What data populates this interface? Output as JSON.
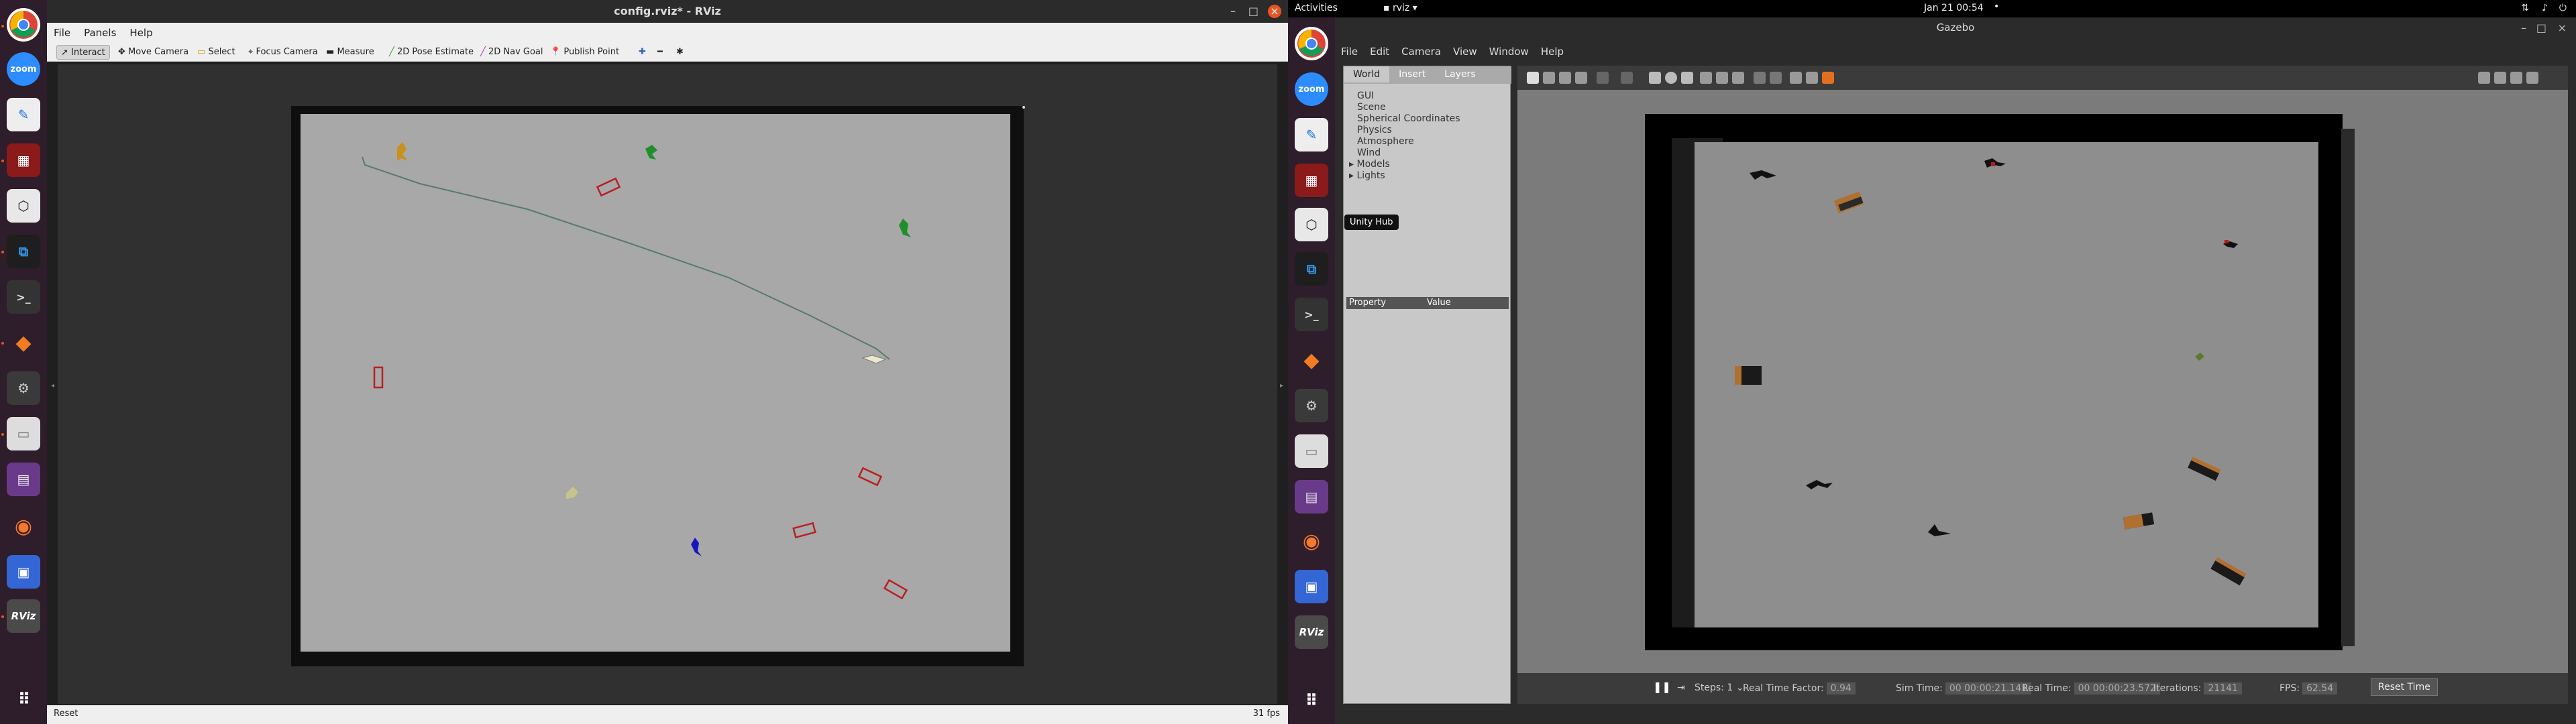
{
  "rviz": {
    "title": "config.rviz* - RViz",
    "menu": [
      "File",
      "Panels",
      "Help"
    ],
    "tools": [
      "Interact",
      "Move Camera",
      "Select",
      "Focus Camera",
      "Measure",
      "2D Pose Estimate",
      "2D Nav Goal",
      "Publish Point"
    ],
    "reset_label": "Reset",
    "fps": "31 fps"
  },
  "topbar": {
    "activities": "Activities",
    "app": "rviz",
    "datetime": "Jan 21  00:54"
  },
  "gazebo": {
    "title": "Gazebo",
    "menu": [
      "File",
      "Edit",
      "Camera",
      "View",
      "Window",
      "Help"
    ],
    "tabs": [
      "World",
      "Insert",
      "Layers"
    ],
    "tree": [
      "GUI",
      "Scene",
      "Spherical Coordinates",
      "Physics",
      "Atmosphere",
      "Wind",
      "Models",
      "Lights"
    ],
    "property_header": "Property",
    "value_header": "Value",
    "tooltip": "Unity Hub",
    "status": {
      "steps_label": "Steps:",
      "steps_value": "1",
      "rtf_label": "Real Time Factor:",
      "rtf_value": "0.94",
      "sim_label": "Sim Time:",
      "sim_value": "00 00:00:21.141",
      "real_label": "Real Time:",
      "real_value": "00 00:00:23.572",
      "iter_label": "Iterations:",
      "iter_value": "21141",
      "fps_label": "FPS:",
      "fps_value": "62.54",
      "reset_time": "Reset Time"
    }
  },
  "dock_icons": [
    "chrome-icon",
    "zoom-icon",
    "text-editor-icon",
    "video-app-icon",
    "unity-hub-icon",
    "vscode-icon",
    "terminal-icon",
    "layers-app-icon",
    "rqt-icon",
    "files-icon",
    "media-app-icon",
    "blender-icon",
    "screenshot-icon",
    "rviz-icon",
    "app-grid-icon"
  ]
}
